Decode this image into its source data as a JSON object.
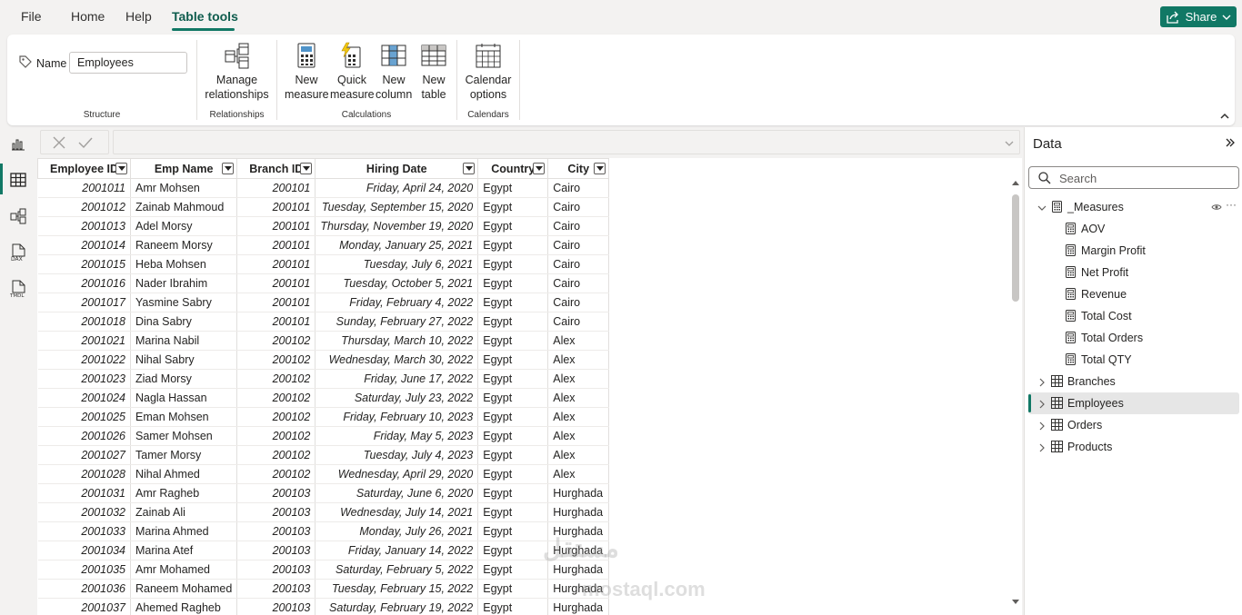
{
  "menu": {
    "file": "File",
    "home": "Home",
    "help": "Help",
    "table_tools": "Table tools",
    "share": "Share"
  },
  "ribbon": {
    "name_label": "Name",
    "name_value": "Employees",
    "structure_label": "Structure",
    "manage_line1": "Manage",
    "manage_line2": "relationships",
    "relationships_label": "Relationships",
    "new_measure_1": "New",
    "new_measure_2": "measure",
    "quick_measure_1": "Quick",
    "quick_measure_2": "measure",
    "new_column_1": "New",
    "new_column_2": "column",
    "new_table_1": "New",
    "new_table_2": "table",
    "calculations_label": "Calculations",
    "calendar_1": "Calendar",
    "calendar_2": "options",
    "calendars_label": "Calendars"
  },
  "table": {
    "columns": [
      "Employee ID",
      "Emp Name",
      "Branch ID",
      "Hiring Date",
      "Country",
      "City"
    ],
    "rows": [
      [
        "2001011",
        "Amr Mohsen",
        "200101",
        "Friday, April 24, 2020",
        "Egypt",
        "Cairo"
      ],
      [
        "2001012",
        "Zainab Mahmoud",
        "200101",
        "Tuesday, September 15, 2020",
        "Egypt",
        "Cairo"
      ],
      [
        "2001013",
        "Adel Morsy",
        "200101",
        "Thursday, November 19, 2020",
        "Egypt",
        "Cairo"
      ],
      [
        "2001014",
        "Raneem Morsy",
        "200101",
        "Monday, January 25, 2021",
        "Egypt",
        "Cairo"
      ],
      [
        "2001015",
        "Heba Mohsen",
        "200101",
        "Tuesday, July 6, 2021",
        "Egypt",
        "Cairo"
      ],
      [
        "2001016",
        "Nader Ibrahim",
        "200101",
        "Tuesday, October 5, 2021",
        "Egypt",
        "Cairo"
      ],
      [
        "2001017",
        "Yasmine Sabry",
        "200101",
        "Friday, February 4, 2022",
        "Egypt",
        "Cairo"
      ],
      [
        "2001018",
        "Dina Sabry",
        "200101",
        "Sunday, February 27, 2022",
        "Egypt",
        "Cairo"
      ],
      [
        "2001021",
        "Marina Nabil",
        "200102",
        "Thursday, March 10, 2022",
        "Egypt",
        "Alex"
      ],
      [
        "2001022",
        "Nihal Sabry",
        "200102",
        "Wednesday, March 30, 2022",
        "Egypt",
        "Alex"
      ],
      [
        "2001023",
        "Ziad Morsy",
        "200102",
        "Friday, June 17, 2022",
        "Egypt",
        "Alex"
      ],
      [
        "2001024",
        "Nagla Hassan",
        "200102",
        "Saturday, July 23, 2022",
        "Egypt",
        "Alex"
      ],
      [
        "2001025",
        "Eman Mohsen",
        "200102",
        "Friday, February 10, 2023",
        "Egypt",
        "Alex"
      ],
      [
        "2001026",
        "Samer Mohsen",
        "200102",
        "Friday, May 5, 2023",
        "Egypt",
        "Alex"
      ],
      [
        "2001027",
        "Tamer Morsy",
        "200102",
        "Tuesday, July 4, 2023",
        "Egypt",
        "Alex"
      ],
      [
        "2001028",
        "Nihal Ahmed",
        "200102",
        "Wednesday, April 29, 2020",
        "Egypt",
        "Alex"
      ],
      [
        "2001031",
        "Amr Ragheb",
        "200103",
        "Saturday, June 6, 2020",
        "Egypt",
        "Hurghada"
      ],
      [
        "2001032",
        "Zainab Ali",
        "200103",
        "Wednesday, July 14, 2021",
        "Egypt",
        "Hurghada"
      ],
      [
        "2001033",
        "Marina Ahmed",
        "200103",
        "Monday, July 26, 2021",
        "Egypt",
        "Hurghada"
      ],
      [
        "2001034",
        "Marina Atef",
        "200103",
        "Friday, January 14, 2022",
        "Egypt",
        "Hurghada"
      ],
      [
        "2001035",
        "Amr Mohamed",
        "200103",
        "Saturday, February 5, 2022",
        "Egypt",
        "Hurghada"
      ],
      [
        "2001036",
        "Raneem Mohamed",
        "200103",
        "Tuesday, February 15, 2022",
        "Egypt",
        "Hurghada"
      ],
      [
        "2001037",
        "Ahemed Ragheb",
        "200103",
        "Saturday, February 19, 2022",
        "Egypt",
        "Hurghada"
      ]
    ]
  },
  "data_pane": {
    "title": "Data",
    "search_placeholder": "Search",
    "measures_table": "_Measures",
    "measures": [
      "AOV",
      "Margin Profit",
      "Net Profit",
      "Revenue",
      "Total Cost",
      "Total Orders",
      "Total QTY"
    ],
    "tables": [
      "Branches",
      "Employees",
      "Orders",
      "Products"
    ],
    "selected_table": "Employees"
  },
  "watermark": {
    "line1": "مستقل",
    "line2": "mostaql.com"
  },
  "colors": {
    "accent": "#117865",
    "border": "#e1dfdd"
  }
}
